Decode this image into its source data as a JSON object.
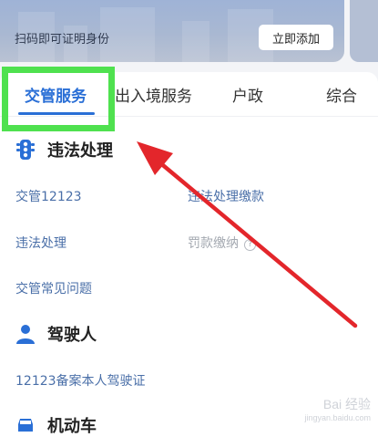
{
  "banner": {
    "text": "扫码即可证明身份",
    "button": "立即添加"
  },
  "tabs": [
    {
      "label": "交管服务",
      "active": true
    },
    {
      "label": "出入境服务"
    },
    {
      "label": "户政"
    },
    {
      "label": "综合"
    }
  ],
  "sections": {
    "violation": {
      "title": "违法处理",
      "links": [
        "交管12123",
        "违法处理缴款",
        "违法处理",
        "罚款缴纳",
        "交管常见问题"
      ]
    },
    "driver": {
      "title": "驾驶人",
      "links": [
        "12123备案本人驾驶证"
      ]
    },
    "vehicle": {
      "title": "机动车"
    }
  },
  "watermark": {
    "main": "Bai 经验",
    "sub": "jingyan.baidu.com"
  },
  "colors": {
    "accent": "#2a6fd6",
    "link": "#4a6fa8",
    "highlight": "#4fe14f",
    "arrow": "#e3262b"
  }
}
